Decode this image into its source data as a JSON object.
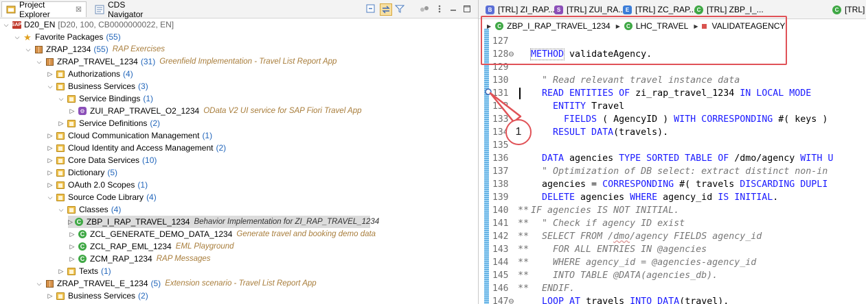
{
  "left_tabs": {
    "project_explorer": "Project Explorer",
    "cds_navigator": "CDS Navigator",
    "close_glyph": "☒"
  },
  "tree": {
    "project": {
      "label": "D20_EN",
      "meta": "[D20, 100, CB0000000022, EN]"
    },
    "favorites": {
      "label": "Favorite Packages",
      "count": "(55)"
    },
    "zrap_1234": {
      "label": "ZRAP_1234",
      "count": "(55)",
      "desc": "RAP Exercises"
    },
    "zrap_travel_1234": {
      "label": "ZRAP_TRAVEL_1234",
      "count": "(31)",
      "desc": "Greenfield Implementation - Travel List Report App"
    },
    "authorizations": {
      "label": "Authorizations",
      "count": "(4)"
    },
    "business_services": {
      "label": "Business Services",
      "count": "(3)"
    },
    "service_bindings": {
      "label": "Service Bindings",
      "count": "(1)"
    },
    "zui_binding": {
      "label": "ZUI_RAP_TRAVEL_O2_1234",
      "desc": "OData V2 UI service for SAP Fiori Travel App"
    },
    "service_definitions": {
      "label": "Service Definitions",
      "count": "(2)"
    },
    "cloud_comm": {
      "label": "Cloud Communication Management",
      "count": "(1)"
    },
    "cloud_identity": {
      "label": "Cloud Identity and Access Management",
      "count": "(2)"
    },
    "core_data": {
      "label": "Core Data Services",
      "count": "(10)"
    },
    "dictionary": {
      "label": "Dictionary",
      "count": "(5)"
    },
    "oauth": {
      "label": "OAuth 2.0 Scopes",
      "count": "(1)"
    },
    "source_lib": {
      "label": "Source Code Library",
      "count": "(4)"
    },
    "classes": {
      "label": "Classes",
      "count": "(4)"
    },
    "zbp_class": {
      "label": "ZBP_I_RAP_TRAVEL_1234",
      "desc": "Behavior Implementation for ZI_RAP_TRAVEL_1234"
    },
    "zcl_gen": {
      "label": "ZCL_GENERATE_DEMO_DATA_1234",
      "desc": "Generate travel and booking demo data"
    },
    "zcl_eml": {
      "label": "ZCL_RAP_EML_1234",
      "desc": "EML Playground"
    },
    "zcm": {
      "label": "ZCM_RAP_1234",
      "desc": "RAP Messages"
    },
    "texts": {
      "label": "Texts",
      "count": "(1)"
    },
    "zrap_travel_e": {
      "label": "ZRAP_TRAVEL_E_1234",
      "count": "(5)",
      "desc": "Extension scenario - Travel List Report App"
    },
    "business_services_2": {
      "label": "Business Services",
      "count": "(2)"
    }
  },
  "editor_tabs": [
    {
      "icon_letter": "B",
      "color": "#5b6fd6",
      "label": "[TRL] ZI_RAP..."
    },
    {
      "icon_letter": "S",
      "color": "#8b4fb8",
      "label": "[TRL] ZUI_RA..."
    },
    {
      "icon_letter": "E",
      "color": "#3b7dd8",
      "label": "[TRL] ZC_RAP..."
    },
    {
      "icon_letter": "C",
      "color": "#3fa845",
      "label": "[TRL] ZBP_I_..."
    },
    {
      "icon_letter": "C",
      "color": "#3fa845",
      "label": "[TRL]"
    }
  ],
  "breadcrumb": {
    "class": "ZBP_I_RAP_TRAVEL_1234",
    "local_class": "LHC_TRAVEL",
    "method": "VALIDATEAGENCY"
  },
  "code_lines": [
    {
      "no": "127",
      "mk": "",
      "parts": []
    },
    {
      "no": "128⊖",
      "mk": "",
      "parts": [
        [
          "kw",
          "METHOD"
        ],
        [
          "",
          "validateAgency."
        ]
      ]
    },
    {
      "no": "129",
      "mk": "",
      "parts": []
    },
    {
      "no": "130",
      "mk": "",
      "parts": [
        [
          "cm",
          "  \" Read relevant travel instance data"
        ]
      ]
    },
    {
      "no": "131",
      "mk": "",
      "parts": [
        [
          "kw",
          "  READ ENTITIES OF"
        ],
        [
          "",
          " zi_rap_travel_1234 "
        ],
        [
          "kw",
          "IN LOCAL MODE"
        ]
      ]
    },
    {
      "no": "132",
      "mk": "",
      "parts": [
        [
          "kw",
          "    ENTITY"
        ],
        [
          "",
          " Travel"
        ]
      ]
    },
    {
      "no": "133",
      "mk": "",
      "parts": [
        [
          "kw",
          "      FIELDS"
        ],
        [
          "",
          " ( AgencyID ) "
        ],
        [
          "kw",
          "WITH CORRESPONDING"
        ],
        [
          "",
          " #( keys )"
        ]
      ]
    },
    {
      "no": "134",
      "mk": "",
      "parts": [
        [
          "kw",
          "    RESULT DATA"
        ],
        [
          "",
          "(travels)."
        ]
      ]
    },
    {
      "no": "135",
      "mk": "",
      "parts": []
    },
    {
      "no": "136",
      "mk": "",
      "parts": [
        [
          "kw",
          "  DATA"
        ],
        [
          "",
          " agencies "
        ],
        [
          "kw",
          "TYPE SORTED TABLE OF"
        ],
        [
          "",
          " /dmo/agency "
        ],
        [
          "kw",
          "WITH U"
        ]
      ]
    },
    {
      "no": "137",
      "mk": "",
      "parts": [
        [
          "cm",
          "  \" Optimization of DB select: extract distinct non-in"
        ]
      ]
    },
    {
      "no": "138",
      "mk": "",
      "parts": [
        [
          "",
          "  agencies = "
        ],
        [
          "kw",
          "CORRESPONDING"
        ],
        [
          "",
          " #( travels "
        ],
        [
          "kw",
          "DISCARDING DUPLI"
        ]
      ]
    },
    {
      "no": "139",
      "mk": "",
      "parts": [
        [
          "kw",
          "  DELETE"
        ],
        [
          "",
          " agencies "
        ],
        [
          "kw",
          "WHERE"
        ],
        [
          "",
          " agency_id "
        ],
        [
          "kw",
          "IS INITIAL"
        ],
        [
          "",
          "."
        ]
      ]
    },
    {
      "no": "140",
      "mk": "**",
      "parts": [
        [
          "cm",
          "IF agencies IS NOT INITIAL."
        ]
      ]
    },
    {
      "no": "141",
      "mk": "**",
      "parts": [
        [
          "cm",
          "  \" Check if agency ID exist"
        ]
      ]
    },
    {
      "no": "142",
      "mk": "**",
      "parts": [
        [
          "cm",
          "  SELECT FROM /"
        ],
        [
          "cmw",
          "dmo"
        ],
        [
          "cm",
          "/agency FIELDS agency_id"
        ]
      ]
    },
    {
      "no": "143",
      "mk": "**",
      "parts": [
        [
          "cm",
          "    FOR ALL ENTRIES IN @agencies"
        ]
      ]
    },
    {
      "no": "144",
      "mk": "**",
      "parts": [
        [
          "cm",
          "    WHERE agency_id = @agencies-agency_id"
        ]
      ]
    },
    {
      "no": "145",
      "mk": "**",
      "parts": [
        [
          "cm",
          "    INTO TABLE @DATA(agencies_db)."
        ]
      ]
    },
    {
      "no": "146",
      "mk": "**",
      "parts": [
        [
          "cm",
          "  ENDIF."
        ]
      ]
    },
    {
      "no": "147⊖",
      "mk": "",
      "parts": [
        [
          "kw",
          "  LOOP AT"
        ],
        [
          "",
          " travels "
        ],
        [
          "kw",
          "INTO DATA"
        ],
        [
          "",
          "(travel)."
        ]
      ]
    }
  ],
  "callout": {
    "number": "1"
  }
}
